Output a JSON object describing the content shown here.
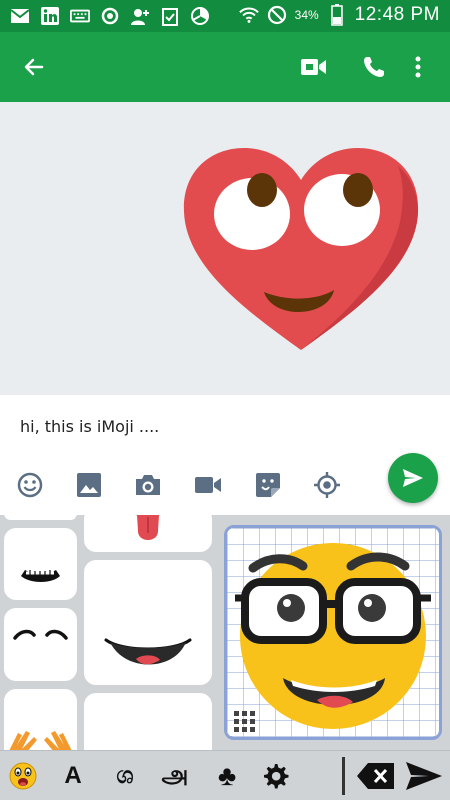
{
  "status_bar": {
    "battery_percent": "34%",
    "time": "12:48 PM",
    "icons": [
      "mail-icon",
      "linkedin-icon",
      "keyboard-icon",
      "sync-icon",
      "add-contact-icon",
      "clipboard-check-icon",
      "pie-chart-icon",
      "wifi-icon",
      "do-not-disturb-icon",
      "battery-icon"
    ]
  },
  "app_bar": {
    "icons": [
      "back-arrow-icon",
      "video-call-icon",
      "phone-icon",
      "more-vert-icon"
    ]
  },
  "chat": {
    "sticker": "heart-emoji-sticker"
  },
  "compose": {
    "message_text": "hi, this is iMoji ....",
    "tools": [
      "emoji-icon",
      "image-icon",
      "camera-icon",
      "video-icon",
      "sticker-icon",
      "location-icon"
    ],
    "send_icon": "send-icon"
  },
  "keyboard_bar": {
    "items": [
      {
        "name": "emoji-face-icon",
        "label": ""
      },
      {
        "name": "latin-keyboard",
        "label": "A"
      },
      {
        "name": "sinhala-keyboard",
        "label": "ශ"
      },
      {
        "name": "tamil-keyboard",
        "label": "அ"
      },
      {
        "name": "symbols-keyboard",
        "label": "♣"
      },
      {
        "name": "settings-icon",
        "label": ""
      }
    ],
    "backspace_icon": "backspace-icon",
    "send_icon": "send-arrow-icon"
  },
  "colors": {
    "status_bar": "#128c3e",
    "app_bar": "#1aa14a",
    "accent": "#1aa14a",
    "chat_bg": "#e9edf0",
    "heart": "#e24c4f",
    "smiley": "#f9c21b"
  }
}
